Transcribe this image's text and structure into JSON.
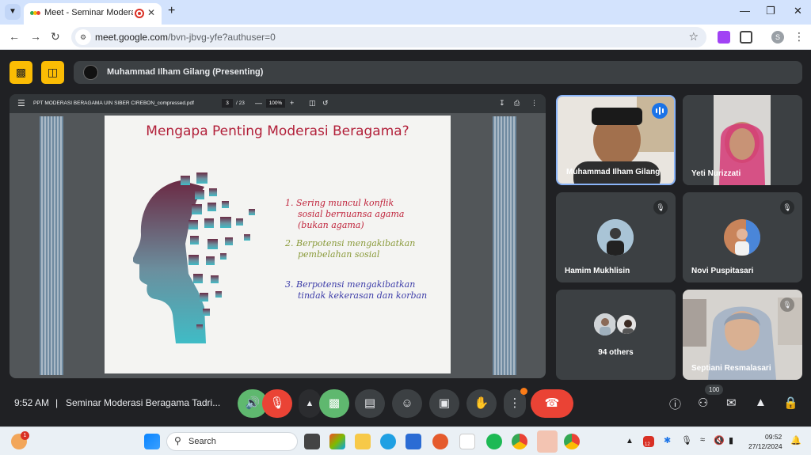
{
  "browser": {
    "tab_title": "Meet - Seminar Moderasi Be",
    "tab_menu_icon": "chevron-down-icon",
    "url_host": "meet.google.com",
    "url_path": "/bvn-jbvg-yfe?authuser=0",
    "profile_initial": "S"
  },
  "meet": {
    "presenter_label": "Muhammad Ilham Gilang (Presenting)",
    "pdf": {
      "filename": "PPT MODERASI BERAGAMA UIN SIBER CIREBON_compressed.pdf",
      "page": "3",
      "page_total": "/ 23",
      "zoom": "100%"
    },
    "slide": {
      "title": "Mengapa Penting Moderasi Beragama?",
      "bullets": [
        {
          "line1": "1. Sering muncul konflik",
          "line2": "sosial bernuansa agama",
          "line3": "(bukan agama)",
          "color": "#c0243c"
        },
        {
          "line1": "2. Berpotensi mengakibatkan",
          "line2": "pembelahan sosial",
          "line3": "",
          "color": "#8a9a3a"
        },
        {
          "line1": "3. Berpotensi mengakibatkan",
          "line2": "tindak kekerasan dan korban",
          "line3": "",
          "color": "#3b3ba8"
        }
      ]
    },
    "participants": [
      {
        "name": "Muhammad Ilham Gilang",
        "muted": false,
        "speaking": true
      },
      {
        "name": "Yeti Nurizzati",
        "muted": false
      },
      {
        "name": "Hamim Mukhlisin",
        "muted": true
      },
      {
        "name": "Novi Puspitasari",
        "muted": true
      },
      {
        "name": "94 others",
        "muted": false
      },
      {
        "name": "Septiani Resmalasari",
        "muted": true
      }
    ],
    "bottom": {
      "time": "9:52 AM",
      "separator": "|",
      "meeting_name": "Seminar Moderasi Beragama Tadri...",
      "people_count": "100"
    }
  },
  "taskbar": {
    "search_label": "Search",
    "notification_count": "1",
    "clock_time": "09:52",
    "clock_date": "27/12/2024",
    "calendar_badge": "12"
  },
  "colors": {
    "accent_blue": "#1a73e8",
    "hangup_red": "#ea4335",
    "mic_on_green": "#5fb86f",
    "presenting_yellow": "#fbbc04"
  }
}
